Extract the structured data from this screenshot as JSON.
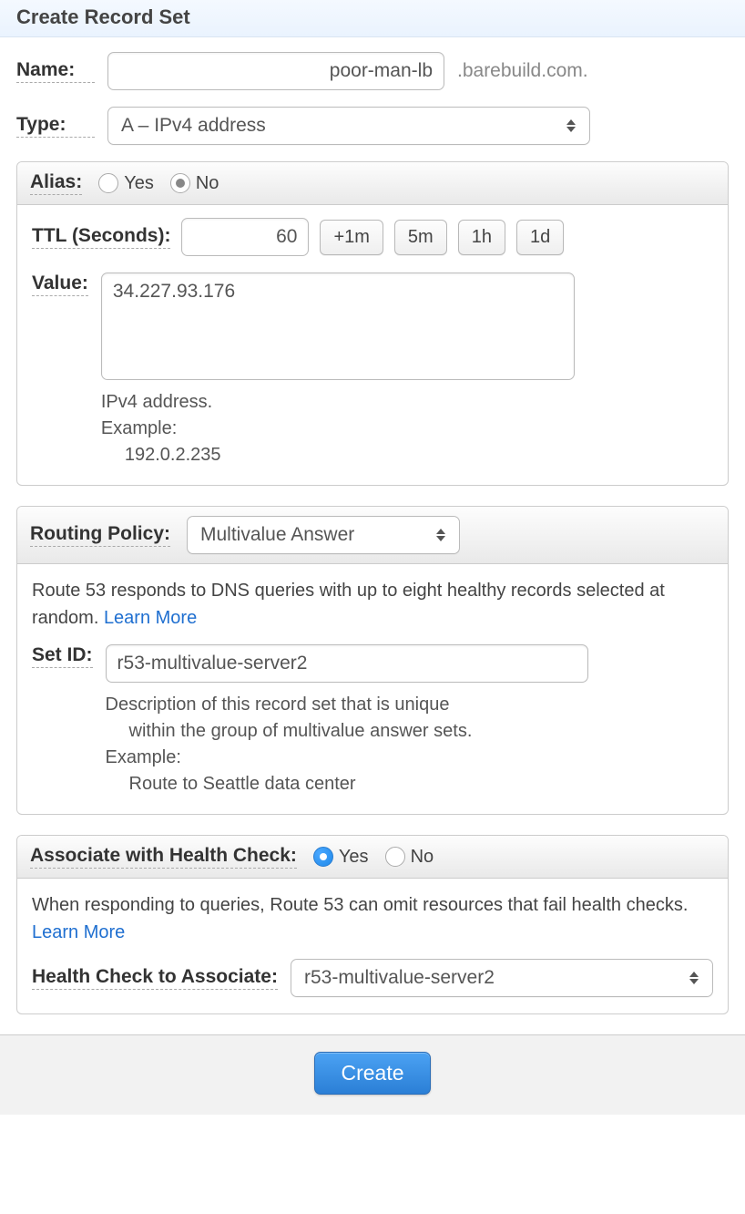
{
  "title": "Create Record Set",
  "name": {
    "label": "Name:",
    "value": "poor-man-lb",
    "suffix": ".barebuild.com."
  },
  "type": {
    "label": "Type:",
    "value": "A – IPv4 address"
  },
  "alias": {
    "label": "Alias:",
    "yes": "Yes",
    "no": "No",
    "selected": "No"
  },
  "ttl": {
    "label": "TTL (Seconds):",
    "value": "60",
    "buttons": {
      "m1": "+1m",
      "m5": "5m",
      "h1": "1h",
      "d1": "1d"
    }
  },
  "value": {
    "label": "Value:",
    "text": "34.227.93.176",
    "help1": "IPv4 address.",
    "help2": "Example:",
    "help3": "192.0.2.235"
  },
  "routing": {
    "label": "Routing Policy:",
    "value": "Multivalue Answer",
    "desc": "Route 53 responds to DNS queries with up to eight healthy records selected at random.  ",
    "learn": "Learn More"
  },
  "setid": {
    "label": "Set ID:",
    "value": "r53-multivalue-server2",
    "help1": "Description of this record set that is unique",
    "help2": "within the group of multivalue answer sets.",
    "help3": "Example:",
    "help4": "Route to Seattle data center"
  },
  "hc": {
    "label": "Associate with Health Check:",
    "yes": "Yes",
    "no": "No",
    "selected": "Yes",
    "desc": "When responding to queries, Route 53 can omit resources that fail health checks.  ",
    "learn": "Learn More",
    "assoc_label": "Health Check to Associate:",
    "assoc_value": "r53-multivalue-server2"
  },
  "create": "Create"
}
